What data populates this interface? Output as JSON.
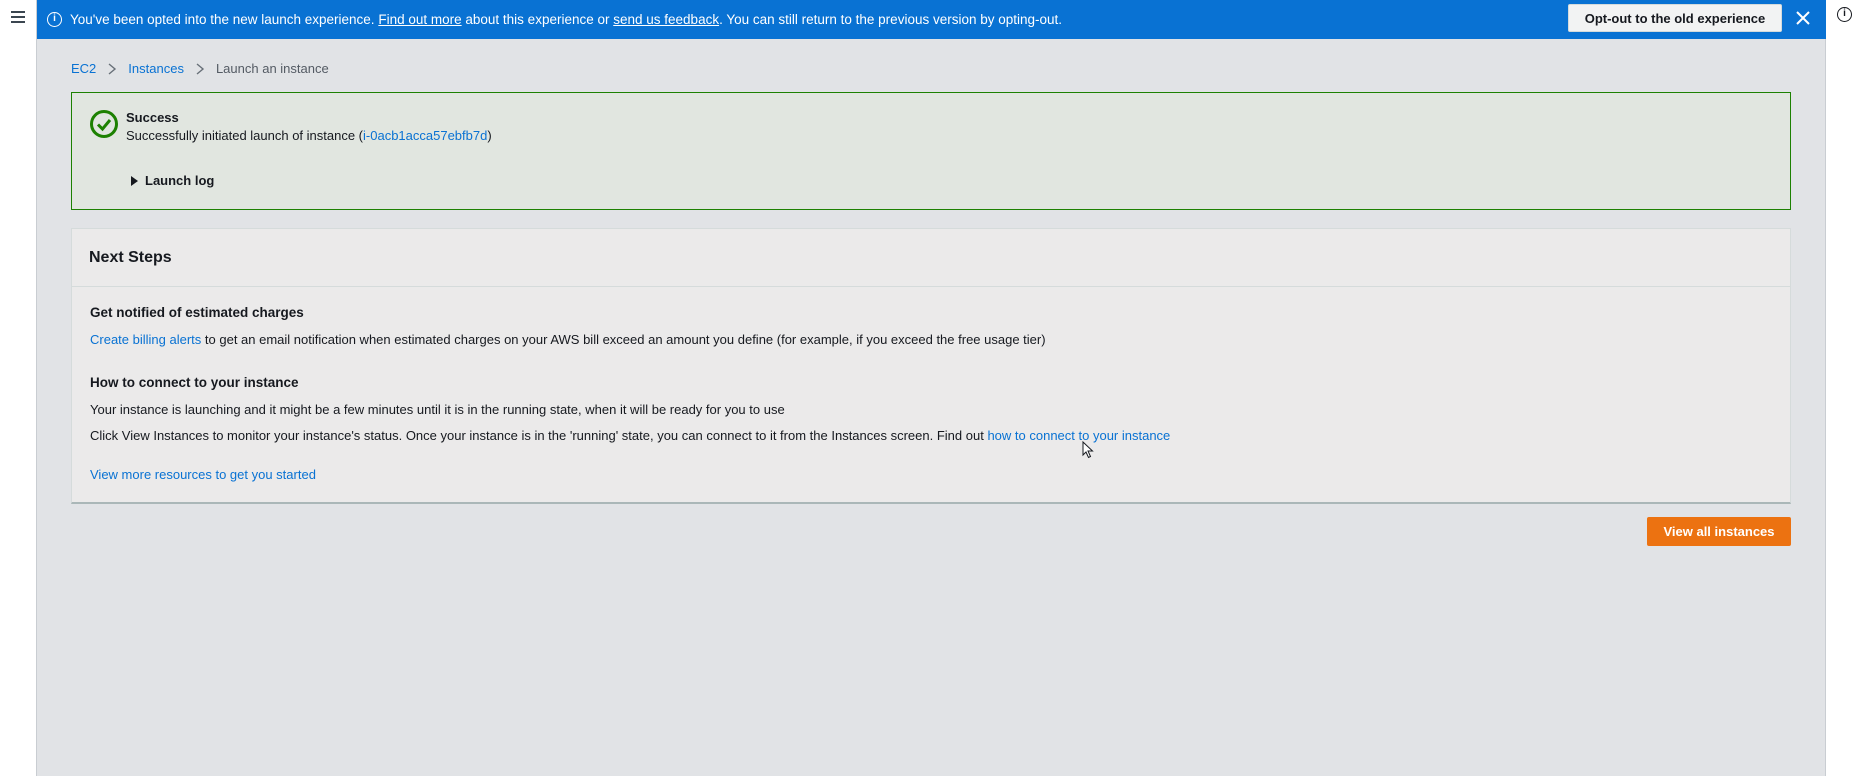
{
  "banner": {
    "prefix": "You've been opted into the new launch experience.",
    "find_out_more": "Find out more",
    "middle": "about this experience or",
    "feedback": "send us feedback",
    "suffix": ". You can still return to the previous version by opting-out.",
    "optout_label": "Opt-out to the old experience",
    "color": "#0972d3"
  },
  "breadcrumb": {
    "items": [
      "EC2",
      "Instances"
    ],
    "current": "Launch an instance"
  },
  "success": {
    "title": "Success",
    "message_prefix": "Successfully initiated launch of instance (",
    "instance_id": "i-0acb1acca57ebfb7d",
    "message_suffix": ")",
    "launch_log_label": "Launch log",
    "color": "#1d8102"
  },
  "next_steps": {
    "title": "Next Steps",
    "billing": {
      "heading": "Get notified of estimated charges",
      "link": "Create billing alerts",
      "text": "to get an email notification when estimated charges on your AWS bill exceed an amount you define (for example, if you exceed the free usage tier)"
    },
    "connect": {
      "heading": "How to connect to your instance",
      "line1": "Your instance is launching and it might be a few minutes until it is in the running state, when it will be ready for you to use",
      "line2_text": "Click View Instances to monitor your instance's status. Once your instance is in the 'running' state, you can connect to it from the Instances screen. Find out",
      "line2_link": "how to connect to your instance"
    },
    "resources_link": "View more resources to get you started"
  },
  "actions": {
    "view_all_label": "View all instances",
    "accent": "#ec7211"
  },
  "icons": {
    "menu": "hamburger-menu-icon",
    "info": "info-icon",
    "close": "close-icon",
    "success": "check-circle-icon",
    "chevron": "chevron-right-icon",
    "caret": "caret-right-icon"
  }
}
